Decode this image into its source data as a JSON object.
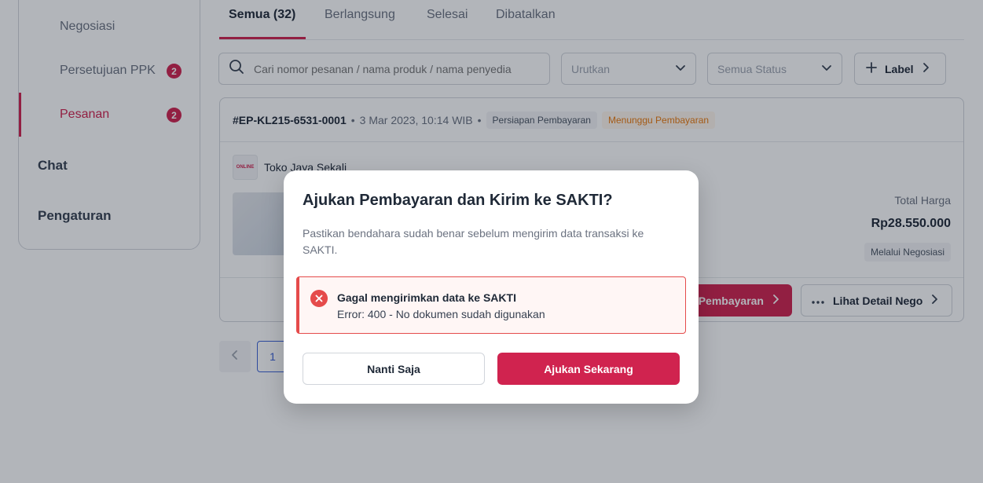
{
  "sidebar": {
    "items": [
      {
        "label": "Negosiasi"
      },
      {
        "label": "Persetujuan PPK",
        "badge": "2"
      },
      {
        "label": "Pesanan",
        "badge": "2"
      }
    ],
    "sections": [
      {
        "label": "Chat"
      },
      {
        "label": "Pengaturan"
      }
    ]
  },
  "tabs": [
    "Semua (32)",
    "Berlangsung",
    "Selesai",
    "Dibatalkan"
  ],
  "filters": {
    "search_placeholder": "Cari nomor pesanan / nama produk / nama penyedia",
    "sort_placeholder": "Urutkan",
    "status_placeholder": "Semua Status",
    "label_button": "Label"
  },
  "order": {
    "id": "#EP-KL215-6531-0001",
    "date": "3 Mar 2023, 10:14 WIB",
    "status_chip": "Persiapan Pembayaran",
    "payment_chip": "Menunggu Pembayaran",
    "store_name": "Toko Jaya Sekali",
    "store_logo_text": "ONLINE",
    "total_label": "Total Harga",
    "total_value": "Rp28.550.000",
    "via_label": "Melalui Negosiasi",
    "pay_button": "Pembayaran",
    "detail_button": "Lihat Detail Nego"
  },
  "pagination": {
    "current": "1"
  },
  "modal": {
    "title": "Ajukan Pembayaran dan Kirim ke SAKTI?",
    "description": "Pastikan bendahara sudah benar sebelum mengirim data transaksi ke SAKTI.",
    "error_title": "Gagal mengirimkan data ke SAKTI",
    "error_message": "Error: 400 - No dokumen sudah digunakan",
    "cancel_label": "Nanti Saja",
    "submit_label": "Ajukan Sekarang"
  },
  "colors": {
    "accent": "#d0234f",
    "error": "#e54b4b",
    "warning": "#ea7a0e",
    "link": "#3b62d6"
  },
  "icons": [
    "search-icon",
    "chevron-down-icon",
    "plus-icon",
    "chevron-right-icon",
    "more-icon",
    "chevron-left-icon",
    "close-icon"
  ]
}
